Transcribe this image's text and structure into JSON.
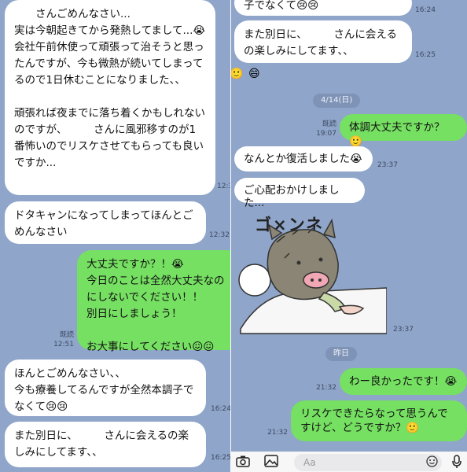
{
  "left": {
    "messages": [
      {
        "text": "　　さんごめんなさい...\n実は今朝起きてから発熱してまして...😭\n会社午前休使って頑張って治そうと思ったんですが、今も微熱が続いてしまってるので1日休むことになりました、、\n\n頑張れば夜までに落ち着くかもしれないのですが、　　　さんに風邪移すのが1番怖いのでリスケさせてもらっても良いですか...",
        "time": "12:3"
      },
      {
        "text": "ドタキャンになってしまってほんとごめんなさい",
        "time": "12:32"
      },
      {
        "text": "大丈夫ですか？！😭\n今日のことは全然大丈夫なのにしないでください！！\n別日にしましょう！\n\nお大事にしてください😖😖",
        "read": "既読",
        "time": "12:51"
      },
      {
        "text": "ほんとごめんなさい、、\n今も療養してるんですが全然本調子でなくて😢😢",
        "time": "16:24"
      },
      {
        "text": "また別日に、　　　さんに会えるの楽しみにしてます、、",
        "time": "16:25"
      }
    ]
  },
  "right": {
    "top_partial": "子でなくて😢😢",
    "top_time": "16:24",
    "messages": [
      {
        "text": "また別日に、　　　さんに会えるの楽しみにしてます、、",
        "time": "16:25"
      },
      {
        "text": "体調大丈夫ですか？🙂",
        "read": "既読",
        "time": "19:07"
      },
      {
        "text": "なんとか復活しました😭",
        "time": "23:37"
      },
      {
        "text": "ご心配おかけしました...",
        "time": ""
      },
      {
        "text": "わー良かったです！😭",
        "time": "21:32"
      },
      {
        "text": "リスケできたらなって思うんですけど、どうですか？🙂",
        "time": "21:32"
      }
    ],
    "date1": "4/14(日)",
    "date2": "昨日",
    "sticker_text": "ゴ×ンネ",
    "sticker_time": "23:37",
    "input_placeholder": "Aa"
  }
}
